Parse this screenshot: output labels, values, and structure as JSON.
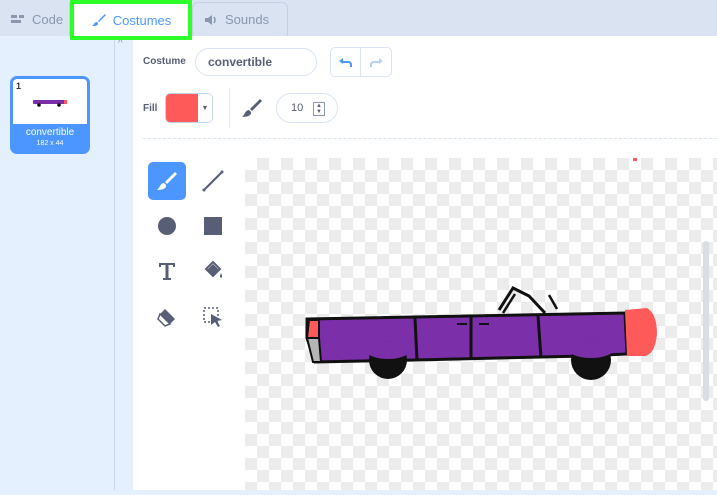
{
  "tabs": {
    "code_label": "Code",
    "costumes_label": "Costumes",
    "sounds_label": "Sounds"
  },
  "costumes": [
    {
      "number": "1",
      "name": "convertible",
      "size": "182 x 44"
    }
  ],
  "editor": {
    "costume_label": "Costume",
    "costume_name": "convertible",
    "fill_label": "Fill",
    "brush_size": "10"
  },
  "colors": {
    "fill": "#ff5a5a",
    "accent": "#4c97ff",
    "highlight_box": "#2dff28",
    "car_body": "#7b2fa8"
  },
  "tools": [
    "brush-tool",
    "line-tool",
    "circle-tool",
    "rectangle-tool",
    "text-tool",
    "fill-tool",
    "eraser-tool",
    "select-tool"
  ]
}
